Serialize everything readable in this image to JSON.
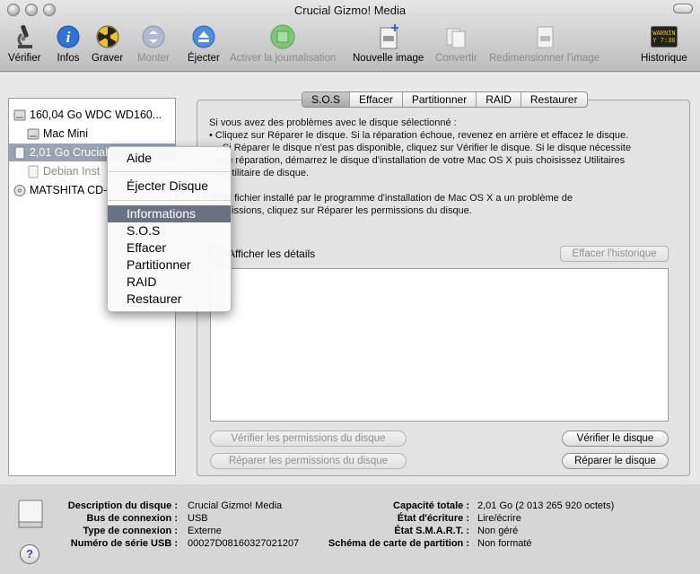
{
  "window": {
    "title": "Crucial Gizmo! Media"
  },
  "toolbar": {
    "verify": "Vérifier",
    "info": "Infos",
    "burn": "Graver",
    "mount": "Monter",
    "eject": "Éjecter",
    "journaling": "Activer la journalisation",
    "new_image": "Nouvelle image",
    "convert": "Convertir",
    "resize": "Redimensionner l'image",
    "history": "Historique",
    "history_icon_text": "WARNIN\nY 7:36"
  },
  "sidebar": {
    "items": [
      {
        "label": "160,04 Go WDC WD160..."
      },
      {
        "label": "Mac Mini"
      },
      {
        "label": "2,01 Go Crucial Gizmo!"
      },
      {
        "label": "Debian Inst"
      },
      {
        "label": "MATSHITA CD-"
      }
    ]
  },
  "tabs": [
    "S.O.S",
    "Effacer",
    "Partitionner",
    "RAID",
    "Restaurer"
  ],
  "help": {
    "line1": "Si vous avez des problèmes avec le disque sélectionné :",
    "line2": "• Cliquez sur Réparer le disque. Si la réparation échoue, revenez en arrière et effacez le disque.",
    "line3": "• Si Réparer le disque n'est pas disponible, cliquez sur Vérifier le disque. Si le disque nécessite",
    "line4": "une réparation, démarrez le disque d'installation de votre Mac OS X puis choisissez Utilitaires",
    "line5": "> Utilitaire de disque.",
    "line6": "Si un fichier installé par le programme d'installation de Mac OS X a un problème de",
    "line7": "permissions, cliquez sur Réparer les permissions du disque."
  },
  "details": {
    "show_details": "Afficher les détails",
    "clear_history": "Effacer l'historique"
  },
  "buttons": {
    "verify_permissions": "Vérifier les permissions du disque",
    "repair_permissions": "Réparer les permissions du disque",
    "verify_disk": "Vérifier le disque",
    "repair_disk": "Réparer le disque"
  },
  "context_menu": {
    "help": "Aide",
    "eject": "Éjecter Disque",
    "items": [
      "Informations",
      "S.O.S",
      "Effacer",
      "Partitionner",
      "RAID",
      "Restaurer"
    ]
  },
  "info": {
    "description_label": "Description du disque :",
    "description": "Crucial Gizmo! Media",
    "bus_label": "Bus de connexion :",
    "bus": "USB",
    "type_label": "Type de connexion :",
    "type": "Externe",
    "serial_label": "Numéro de série USB :",
    "serial": "00027D08160327021207",
    "capacity_label": "Capacité totale :",
    "capacity": "2,01 Go (2 013 265 920 octets)",
    "write_label": "État d'écriture :",
    "write": "Lire/écrire",
    "smart_label": "État S.M.A.R.T. :",
    "smart": "Non géré",
    "scheme_label": "Schéma de carte de partition :",
    "scheme": "Non formaté"
  },
  "help_button": "?"
}
